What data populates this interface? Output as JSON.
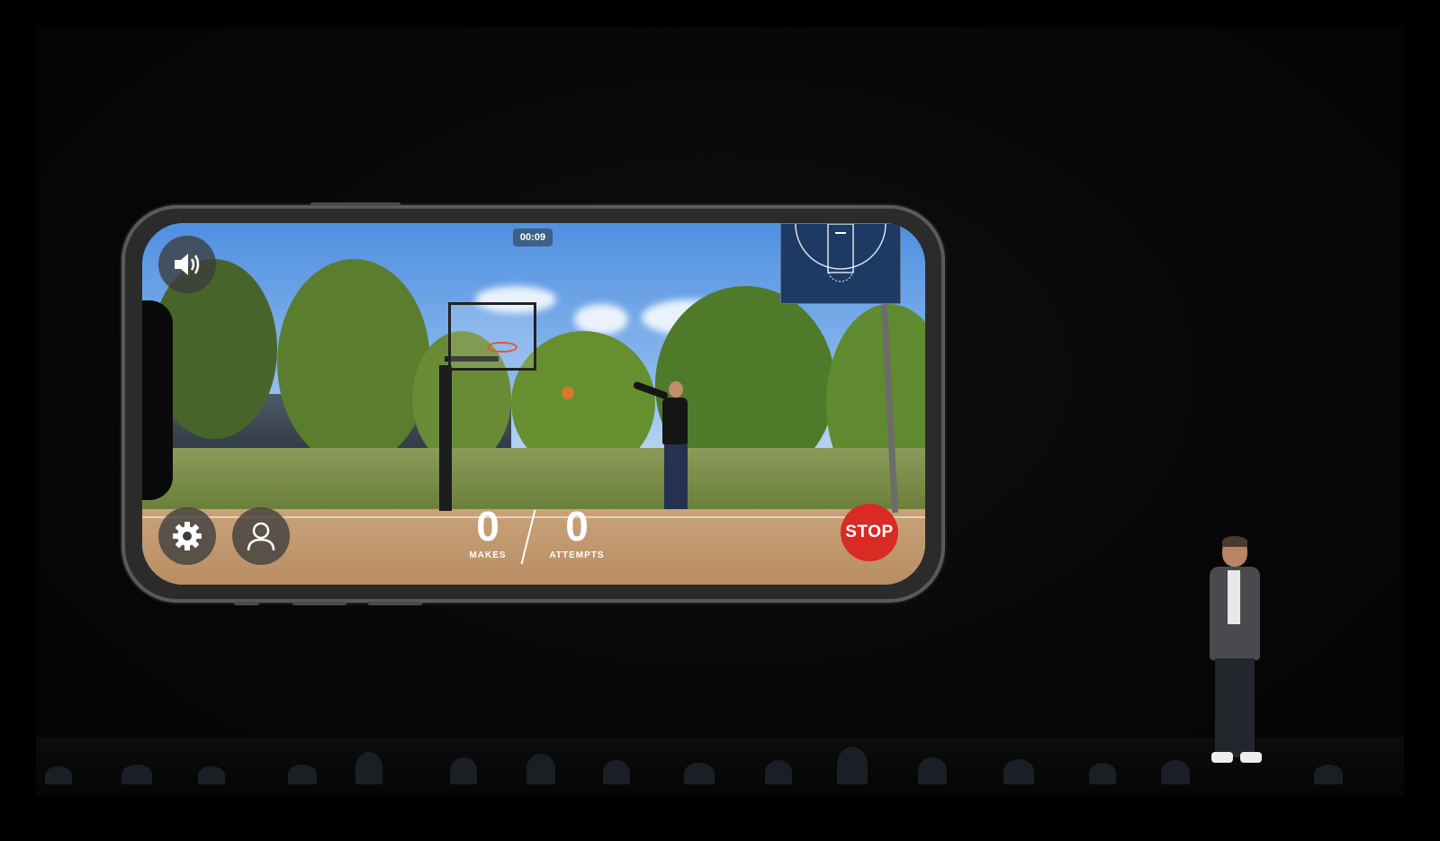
{
  "game": {
    "timer": "00:09",
    "makes": {
      "value": "0",
      "label": "MAKES"
    },
    "attempts": {
      "value": "0",
      "label": "ATTEMPTS"
    },
    "stop_label": "STOP",
    "icons": {
      "sound": "speaker-icon",
      "settings": "gear-icon",
      "profile": "user-icon",
      "minimap": "court-minimap"
    }
  },
  "colors": {
    "stop": "#d92a24",
    "timer_bg": "#3e5f86",
    "minimap_bg": "#1c3a63"
  }
}
